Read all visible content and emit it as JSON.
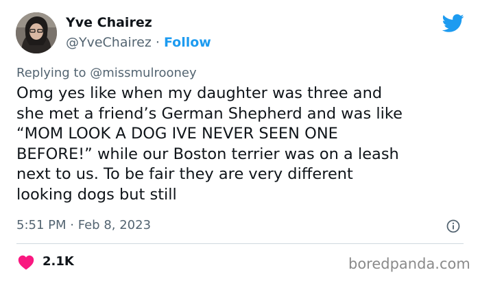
{
  "author": {
    "name": "Yve Chairez",
    "handle": "@YveChairez",
    "separator": "·",
    "follow_label": "Follow"
  },
  "reply": {
    "prefix": "Replying to",
    "mention": "@missmulrooney"
  },
  "tweet": {
    "text": "Omg yes like when my daughter was three and\nshe met a friend’s German Shepherd and was like\n“MOM LOOK A DOG IVE NEVER SEEN ONE\nBEFORE!” while our Boston terrier was on a leash\nnext to us. To be fair they are very different\nlooking dogs but still",
    "time": "5:51 PM",
    "separator": "·",
    "date": "Feb 8, 2023"
  },
  "engagement": {
    "likes": "2.1K"
  },
  "watermark": "boredpanda.com",
  "icons": {
    "brand": "twitter-bird-icon",
    "info": "info-icon",
    "like": "heart-icon"
  },
  "colors": {
    "accent": "#1d9bf0",
    "text": "#0f1419",
    "secondary": "#536471",
    "heart": "#f91880",
    "divider": "#cfd9de"
  }
}
